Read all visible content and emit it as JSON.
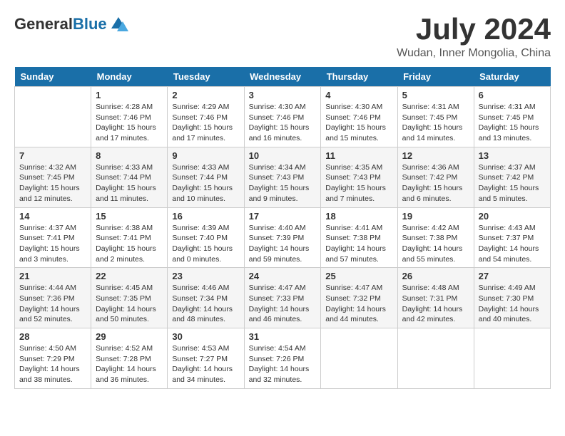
{
  "header": {
    "logo": {
      "text_general": "General",
      "text_blue": "Blue"
    },
    "title": "July 2024",
    "location": "Wudan, Inner Mongolia, China"
  },
  "calendar": {
    "days_of_week": [
      "Sunday",
      "Monday",
      "Tuesday",
      "Wednesday",
      "Thursday",
      "Friday",
      "Saturday"
    ],
    "weeks": [
      [
        {
          "day": "",
          "info": ""
        },
        {
          "day": "1",
          "info": "Sunrise: 4:28 AM\nSunset: 7:46 PM\nDaylight: 15 hours\nand 17 minutes."
        },
        {
          "day": "2",
          "info": "Sunrise: 4:29 AM\nSunset: 7:46 PM\nDaylight: 15 hours\nand 17 minutes."
        },
        {
          "day": "3",
          "info": "Sunrise: 4:30 AM\nSunset: 7:46 PM\nDaylight: 15 hours\nand 16 minutes."
        },
        {
          "day": "4",
          "info": "Sunrise: 4:30 AM\nSunset: 7:46 PM\nDaylight: 15 hours\nand 15 minutes."
        },
        {
          "day": "5",
          "info": "Sunrise: 4:31 AM\nSunset: 7:45 PM\nDaylight: 15 hours\nand 14 minutes."
        },
        {
          "day": "6",
          "info": "Sunrise: 4:31 AM\nSunset: 7:45 PM\nDaylight: 15 hours\nand 13 minutes."
        }
      ],
      [
        {
          "day": "7",
          "info": "Sunrise: 4:32 AM\nSunset: 7:45 PM\nDaylight: 15 hours\nand 12 minutes."
        },
        {
          "day": "8",
          "info": "Sunrise: 4:33 AM\nSunset: 7:44 PM\nDaylight: 15 hours\nand 11 minutes."
        },
        {
          "day": "9",
          "info": "Sunrise: 4:33 AM\nSunset: 7:44 PM\nDaylight: 15 hours\nand 10 minutes."
        },
        {
          "day": "10",
          "info": "Sunrise: 4:34 AM\nSunset: 7:43 PM\nDaylight: 15 hours\nand 9 minutes."
        },
        {
          "day": "11",
          "info": "Sunrise: 4:35 AM\nSunset: 7:43 PM\nDaylight: 15 hours\nand 7 minutes."
        },
        {
          "day": "12",
          "info": "Sunrise: 4:36 AM\nSunset: 7:42 PM\nDaylight: 15 hours\nand 6 minutes."
        },
        {
          "day": "13",
          "info": "Sunrise: 4:37 AM\nSunset: 7:42 PM\nDaylight: 15 hours\nand 5 minutes."
        }
      ],
      [
        {
          "day": "14",
          "info": "Sunrise: 4:37 AM\nSunset: 7:41 PM\nDaylight: 15 hours\nand 3 minutes."
        },
        {
          "day": "15",
          "info": "Sunrise: 4:38 AM\nSunset: 7:41 PM\nDaylight: 15 hours\nand 2 minutes."
        },
        {
          "day": "16",
          "info": "Sunrise: 4:39 AM\nSunset: 7:40 PM\nDaylight: 15 hours\nand 0 minutes."
        },
        {
          "day": "17",
          "info": "Sunrise: 4:40 AM\nSunset: 7:39 PM\nDaylight: 14 hours\nand 59 minutes."
        },
        {
          "day": "18",
          "info": "Sunrise: 4:41 AM\nSunset: 7:38 PM\nDaylight: 14 hours\nand 57 minutes."
        },
        {
          "day": "19",
          "info": "Sunrise: 4:42 AM\nSunset: 7:38 PM\nDaylight: 14 hours\nand 55 minutes."
        },
        {
          "day": "20",
          "info": "Sunrise: 4:43 AM\nSunset: 7:37 PM\nDaylight: 14 hours\nand 54 minutes."
        }
      ],
      [
        {
          "day": "21",
          "info": "Sunrise: 4:44 AM\nSunset: 7:36 PM\nDaylight: 14 hours\nand 52 minutes."
        },
        {
          "day": "22",
          "info": "Sunrise: 4:45 AM\nSunset: 7:35 PM\nDaylight: 14 hours\nand 50 minutes."
        },
        {
          "day": "23",
          "info": "Sunrise: 4:46 AM\nSunset: 7:34 PM\nDaylight: 14 hours\nand 48 minutes."
        },
        {
          "day": "24",
          "info": "Sunrise: 4:47 AM\nSunset: 7:33 PM\nDaylight: 14 hours\nand 46 minutes."
        },
        {
          "day": "25",
          "info": "Sunrise: 4:47 AM\nSunset: 7:32 PM\nDaylight: 14 hours\nand 44 minutes."
        },
        {
          "day": "26",
          "info": "Sunrise: 4:48 AM\nSunset: 7:31 PM\nDaylight: 14 hours\nand 42 minutes."
        },
        {
          "day": "27",
          "info": "Sunrise: 4:49 AM\nSunset: 7:30 PM\nDaylight: 14 hours\nand 40 minutes."
        }
      ],
      [
        {
          "day": "28",
          "info": "Sunrise: 4:50 AM\nSunset: 7:29 PM\nDaylight: 14 hours\nand 38 minutes."
        },
        {
          "day": "29",
          "info": "Sunrise: 4:52 AM\nSunset: 7:28 PM\nDaylight: 14 hours\nand 36 minutes."
        },
        {
          "day": "30",
          "info": "Sunrise: 4:53 AM\nSunset: 7:27 PM\nDaylight: 14 hours\nand 34 minutes."
        },
        {
          "day": "31",
          "info": "Sunrise: 4:54 AM\nSunset: 7:26 PM\nDaylight: 14 hours\nand 32 minutes."
        },
        {
          "day": "",
          "info": ""
        },
        {
          "day": "",
          "info": ""
        },
        {
          "day": "",
          "info": ""
        }
      ]
    ]
  }
}
